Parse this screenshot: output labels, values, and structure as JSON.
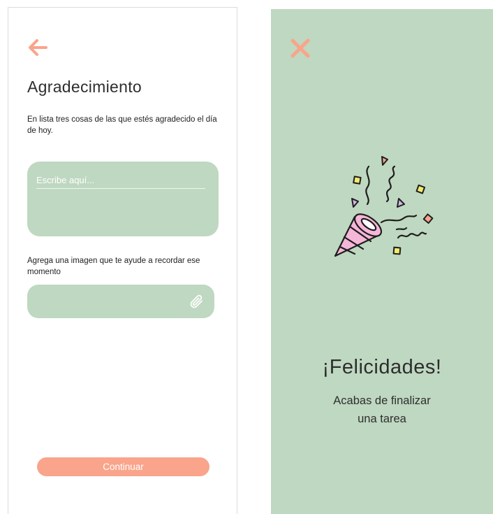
{
  "gratitude_screen": {
    "title": "Agradecimiento",
    "description": "En lista tres cosas de las que estés agradecido el día de hoy.",
    "input_placeholder": "Escribe aquí...",
    "image_label": "Agrega una imagen que te ayude a recordar ese momento",
    "continue_label": "Continuar",
    "icons": {
      "back": "arrow-left-icon",
      "attach": "paperclip-icon"
    }
  },
  "success_screen": {
    "heading": "¡Felicidades!",
    "message_line1": "Acabas de finalizar",
    "message_line2": "una tarea",
    "icons": {
      "close": "close-x-icon",
      "illustration": "party-popper-icon"
    }
  },
  "colors": {
    "accent": "#f9a48b",
    "green_surface": "#bfd8c1",
    "text_dark": "#2e2e2e"
  }
}
